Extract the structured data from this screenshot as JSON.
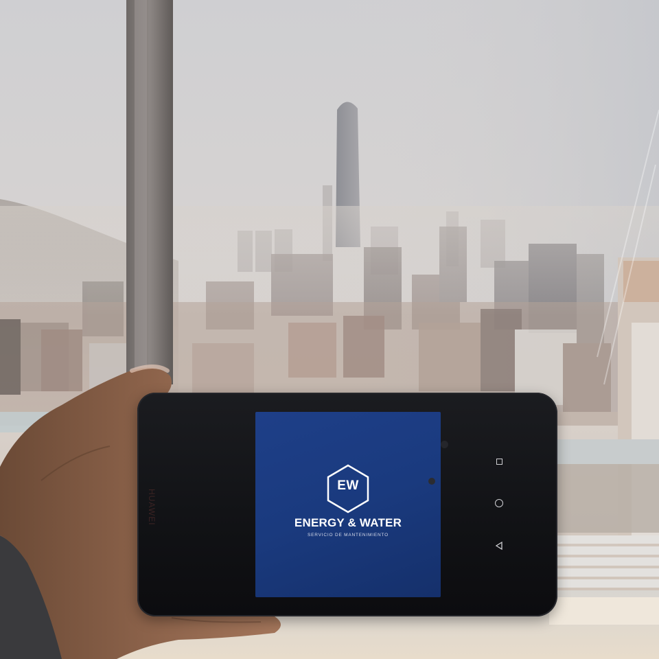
{
  "phone": {
    "brand_mark": "HUAWEI",
    "screen": {
      "logo_initials": "EW",
      "company_name": "ENERGY & WATER",
      "tagline": "SERVICIO DE MANTENIMIENTO",
      "background_color": "#1c3b82",
      "text_color": "#ffffff"
    },
    "nav_bar": {
      "recent_icon": "square-icon",
      "home_icon": "circle-icon",
      "back_icon": "triangle-back-icon"
    }
  },
  "scene": {
    "sky_color": "#c9c9cc",
    "haze_color": "#d9d3cc"
  }
}
